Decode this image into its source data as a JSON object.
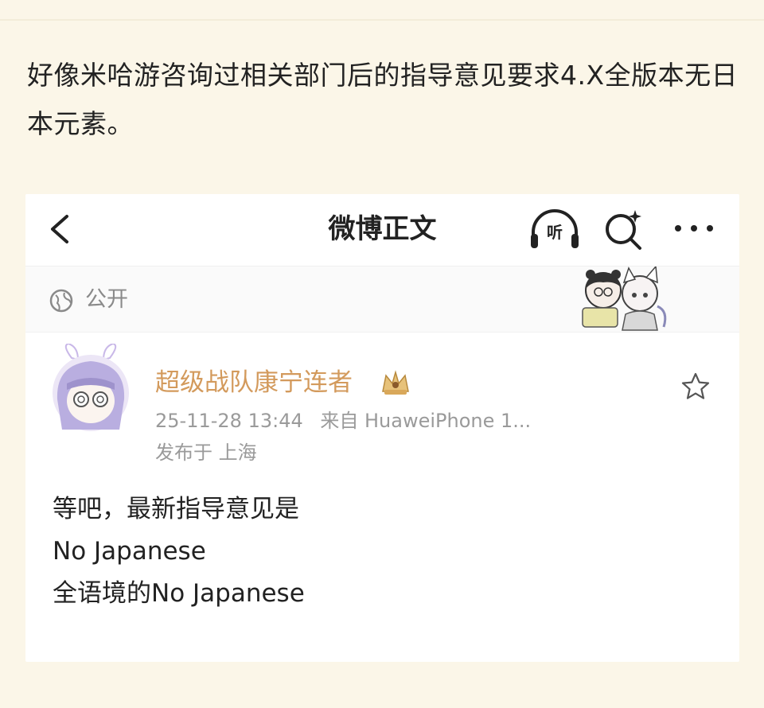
{
  "post": {
    "text": "好像米哈游咨询过相关部门后的指导意见要求4.X全版本无日本元素。"
  },
  "weibo_screenshot": {
    "nav": {
      "title": "微博正文",
      "listen_label": "听"
    },
    "visibility": {
      "label": "公开"
    },
    "author": {
      "username": "超级战队康宁连者",
      "timestamp": "25-11-28 13:44",
      "source": "来自 HuaweiPhone 1...",
      "location": "发布于 上海"
    },
    "body_lines": [
      "等吧，最新指导意见是",
      "No Japanese",
      "全语境的No Japanese"
    ]
  },
  "colors": {
    "page_background": "#fbf6e8",
    "username": "#d39a5c",
    "meta_text": "#9a9a9a"
  },
  "icons": [
    "back-icon",
    "headphones-icon",
    "search-icon",
    "more-icon",
    "globe-icon",
    "vip-crown-icon",
    "star-icon"
  ]
}
